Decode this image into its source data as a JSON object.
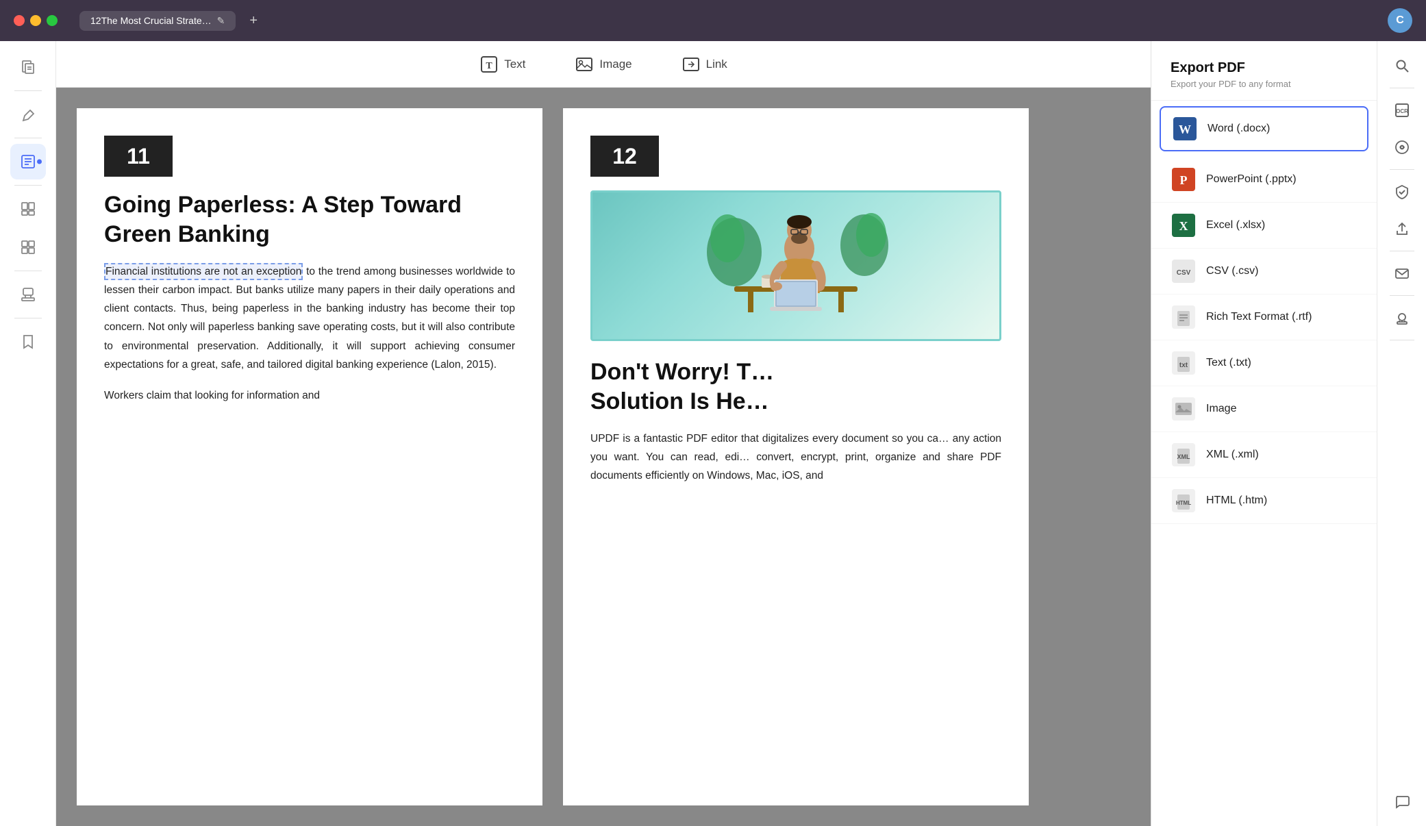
{
  "titlebar": {
    "tab_title": "12The Most Crucial Strate…",
    "edit_icon": "✎",
    "new_tab_icon": "+",
    "avatar_letter": "C"
  },
  "toolbar": {
    "text_label": "Text",
    "image_label": "Image",
    "link_label": "Link"
  },
  "export_panel": {
    "title": "Export PDF",
    "subtitle": "Export your PDF to any format",
    "options": [
      {
        "id": "word",
        "label": "Word (.docx)",
        "selected": true
      },
      {
        "id": "powerpoint",
        "label": "PowerPoint (.pptx)",
        "selected": false
      },
      {
        "id": "excel",
        "label": "Excel (.xlsx)",
        "selected": false
      },
      {
        "id": "csv",
        "label": "CSV (.csv)",
        "selected": false
      },
      {
        "id": "rtf",
        "label": "Rich Text Format (.rtf)",
        "selected": false
      },
      {
        "id": "txt",
        "label": "Text (.txt)",
        "selected": false
      },
      {
        "id": "image",
        "label": "Image",
        "selected": false
      },
      {
        "id": "xml",
        "label": "XML (.xml)",
        "selected": false
      },
      {
        "id": "html",
        "label": "HTML (.htm)",
        "selected": false
      }
    ]
  },
  "page11": {
    "number": "11",
    "title": "Going Paperless: A Step Toward Green Banking",
    "highlighted_text": "Financial institutions are not an exception",
    "body_text": " to the trend among businesses worldwide to lessen their carbon impact. But banks utilize many papers in their daily operations and client contacts. Thus, being paperless in the banking industry has become their top concern. Not only will paperless banking save operating costs, but it will also contribute to environmental preservation. Additionally, it will support achieving consumer expectations for a great, safe, and tailored digital banking experience (Lalon, 2015).",
    "body_text2": "Workers claim that looking for information and"
  },
  "page12": {
    "number": "12",
    "title_partial": "Don't Worry! T… Solution Is He…",
    "body_text": "UPDF is a fantastic PDF editor that digitalizes every document so you ca… any action you want. You can read, edi… convert, encrypt, print, organize and share PDF documents efficiently on Windows, Mac, iOS, and"
  }
}
